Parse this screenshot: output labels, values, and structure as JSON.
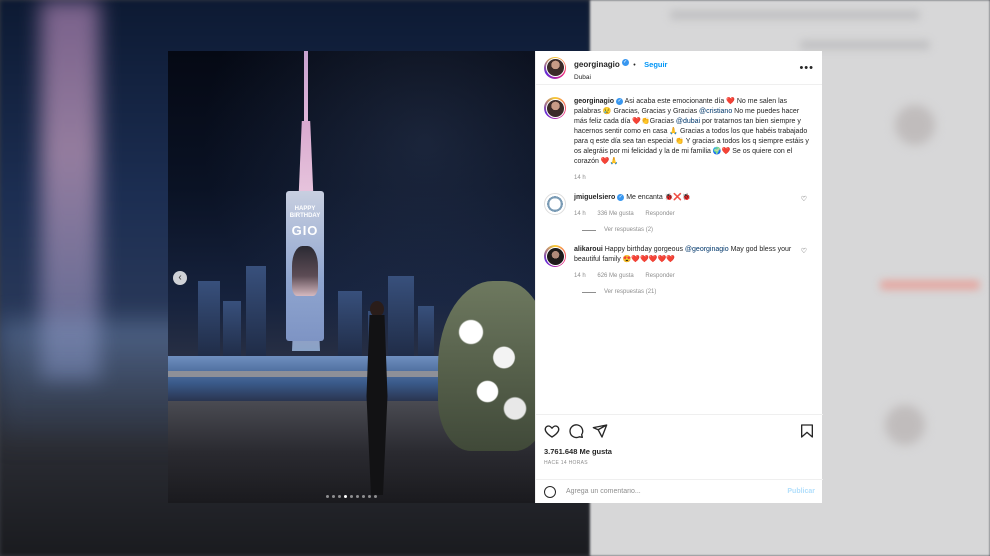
{
  "post": {
    "username": "georginagio",
    "follow_label": "Seguir",
    "location": "Dubai",
    "more_label": "•••",
    "billboard_line1": "HAPPY",
    "billboard_line2": "BIRTHDAY",
    "billboard_name": "GIO",
    "slide_count": 9,
    "active_slide": 4
  },
  "caption": {
    "username": "georginagio",
    "segments": [
      {
        "t": "Asi acaba este emocionante día ❤️ No me salen las palabras 😢 Gracias, Gracias y Gracias "
      },
      {
        "m": "@cristiano"
      },
      {
        "t": " No me puedes hacer más feliz cada día ❤️👏Gracias "
      },
      {
        "m": "@dubai"
      },
      {
        "t": " por tratarnos tan bien siempre y hacernos sentir como en casa 🙏 Gracias a todos los que habéis trabajado para q este día sea tan especial 👏 Y gracias a todos los q siempre estáis y os alegráis por mi felicidad y la de mi familia 🌍❤️ Se os quiere con el corazón ❤️🙏"
      }
    ],
    "time": "14 h"
  },
  "comments": [
    {
      "username": "jmiguelsiero",
      "text": "Me encanta 🐞❌🐞",
      "time": "14 h",
      "likes": "336 Me gusta",
      "reply_label": "Responder",
      "view_replies": "Ver respuestas (2)"
    },
    {
      "username": "alikaroui",
      "text_prefix": "Happy birthday gorgeous ",
      "mention": "@georginagio",
      "text_suffix": " May god bless your beautiful family 😍❤️❤️❤️❤️❤️",
      "time": "14 h",
      "likes": "626 Me gusta",
      "reply_label": "Responder",
      "view_replies": "Ver respuestas (21)"
    }
  ],
  "stats": {
    "likes": "3.761.648 Me gusta",
    "time_ago": "HACE 14 HORAS"
  },
  "composer": {
    "placeholder": "Agrega un comentario...",
    "publish_label": "Publicar"
  },
  "colors": {
    "link": "#0095f6",
    "mention": "#00376b",
    "muted": "#8e8e8e",
    "verified": "#3897f0"
  }
}
